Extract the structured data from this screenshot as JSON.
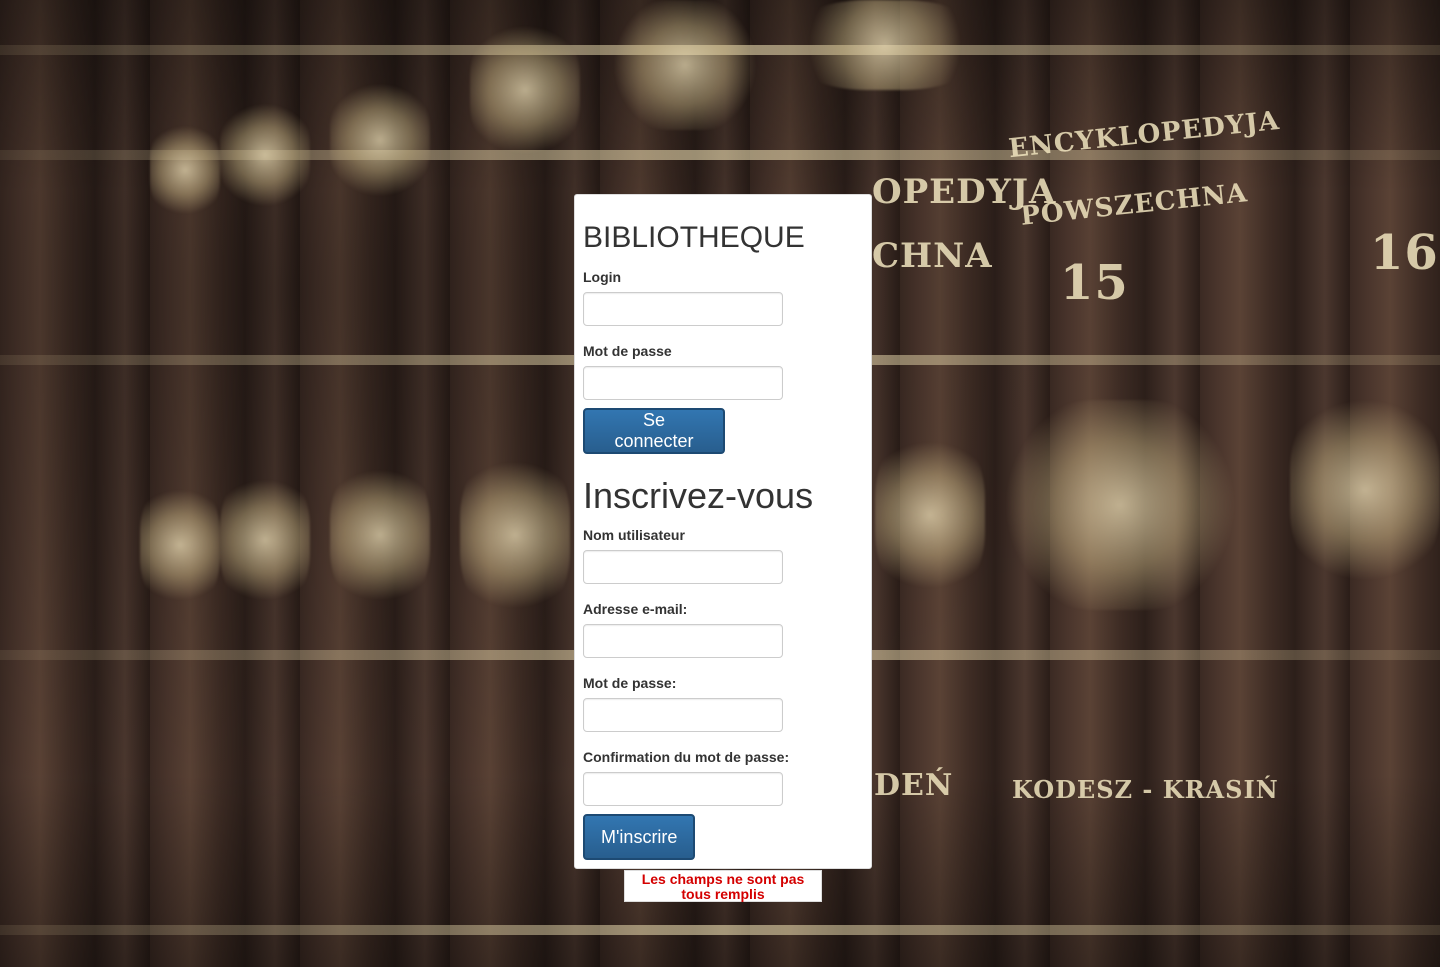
{
  "login_section": {
    "title": "BIBLIOTHEQUE",
    "login_label": "Login",
    "password_label": "Mot de passe",
    "submit_label": "Se connecter"
  },
  "register_section": {
    "title": "Inscrivez-vous",
    "username_label": "Nom utilisateur",
    "email_label": "Adresse e-mail:",
    "password_label": "Mot de passe:",
    "confirm_label": "Confirmation du mot de passe:",
    "submit_label": "M'inscrire"
  },
  "error_message": "Les champs ne sont pas tous remplis",
  "background": {
    "spine_texts": [
      "ENCYKLOPEDYJA",
      "POWSZECHNA",
      "15",
      "16",
      "KODESZ - KRASIŃ",
      "OPEDYJA",
      "CHNA",
      "DEŃ"
    ]
  },
  "colors": {
    "primary_button": "#2e6da4",
    "error_text": "#d40000"
  }
}
